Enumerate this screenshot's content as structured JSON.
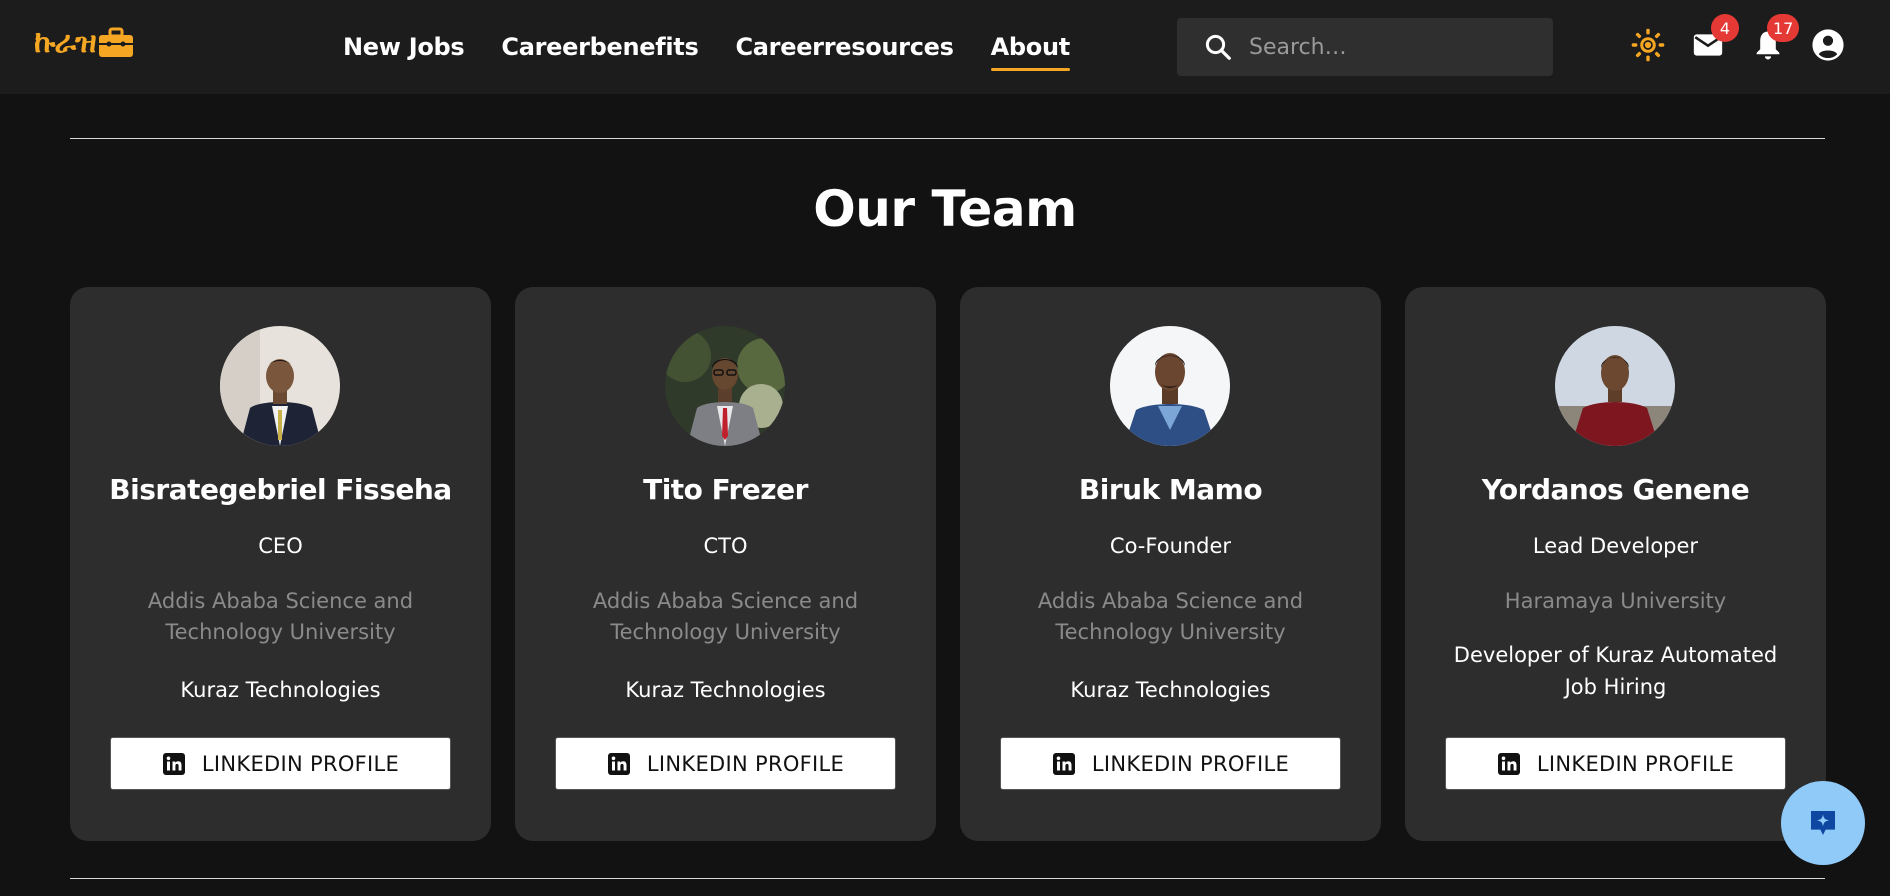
{
  "brand": {
    "logo_text": "ኩራዝ",
    "accent": "#f5a623"
  },
  "nav": {
    "links": [
      {
        "label": "New Jobs"
      },
      {
        "label": "Careerbenefits"
      },
      {
        "label": "Careerresources"
      },
      {
        "label": "About",
        "active": true
      }
    ],
    "search_placeholder": "Search…",
    "messages_badge": "4",
    "notifications_badge": "17",
    "icons": [
      "theme-toggle-icon",
      "mail-icon",
      "bell-icon",
      "account-icon"
    ]
  },
  "section": {
    "title": "Our Team"
  },
  "team": [
    {
      "name": "Bisrategebriel Fisseha",
      "role": "CEO",
      "school": "Addis Ababa Science and Technology University",
      "org": "Kuraz Technologies",
      "button": "LINKEDIN PROFILE"
    },
    {
      "name": "Tito Frezer",
      "role": "CTO",
      "school": "Addis Ababa Science and Technology University",
      "org": "Kuraz Technologies",
      "button": "LINKEDIN PROFILE"
    },
    {
      "name": "Biruk Mamo",
      "role": "Co-Founder",
      "school": "Addis Ababa Science and Technology University",
      "org": "Kuraz Technologies",
      "button": "LINKEDIN PROFILE"
    },
    {
      "name": "Yordanos Genene",
      "role": "Lead Developer",
      "school": "Haramaya University",
      "org": "Developer of Kuraz Automated Job Hiring",
      "button": "LINKEDIN PROFILE"
    }
  ],
  "colors": {
    "background": "#121212",
    "navbar": "#1c1c1c",
    "card": "#2d2d2d",
    "badge": "#e53935",
    "fab": "#90caf9"
  }
}
